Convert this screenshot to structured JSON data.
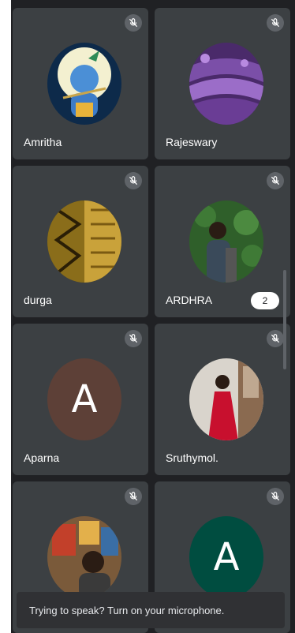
{
  "participants": [
    {
      "name": "Amritha",
      "avatar": "krishna-art-photo",
      "muted": true
    },
    {
      "name": "Rajeswary",
      "avatar": "purple-lavender-photo",
      "muted": true
    },
    {
      "name": "durga",
      "avatar": "golden-abstract-art-photo",
      "muted": true
    },
    {
      "name": "ARDHRA",
      "avatar": "woman-by-plants-photo",
      "muted": true,
      "badge": "2"
    },
    {
      "name": "Aparna",
      "avatar_letter": "A",
      "avatar_color": "#5d4037",
      "muted": true
    },
    {
      "name": "Sruthymol.",
      "avatar": "woman-red-dress-photo",
      "muted": true
    },
    {
      "name": "",
      "avatar": "woman-with-paintings-photo",
      "muted": true
    },
    {
      "name": "",
      "avatar_letter": "A",
      "avatar_color": "#004d40",
      "muted": true
    }
  ],
  "snackbar": {
    "text": "Trying to speak? Turn on your microphone."
  },
  "colors": {
    "background": "#202124",
    "tile": "#3c4043",
    "mic_badge": "#5f6368"
  }
}
